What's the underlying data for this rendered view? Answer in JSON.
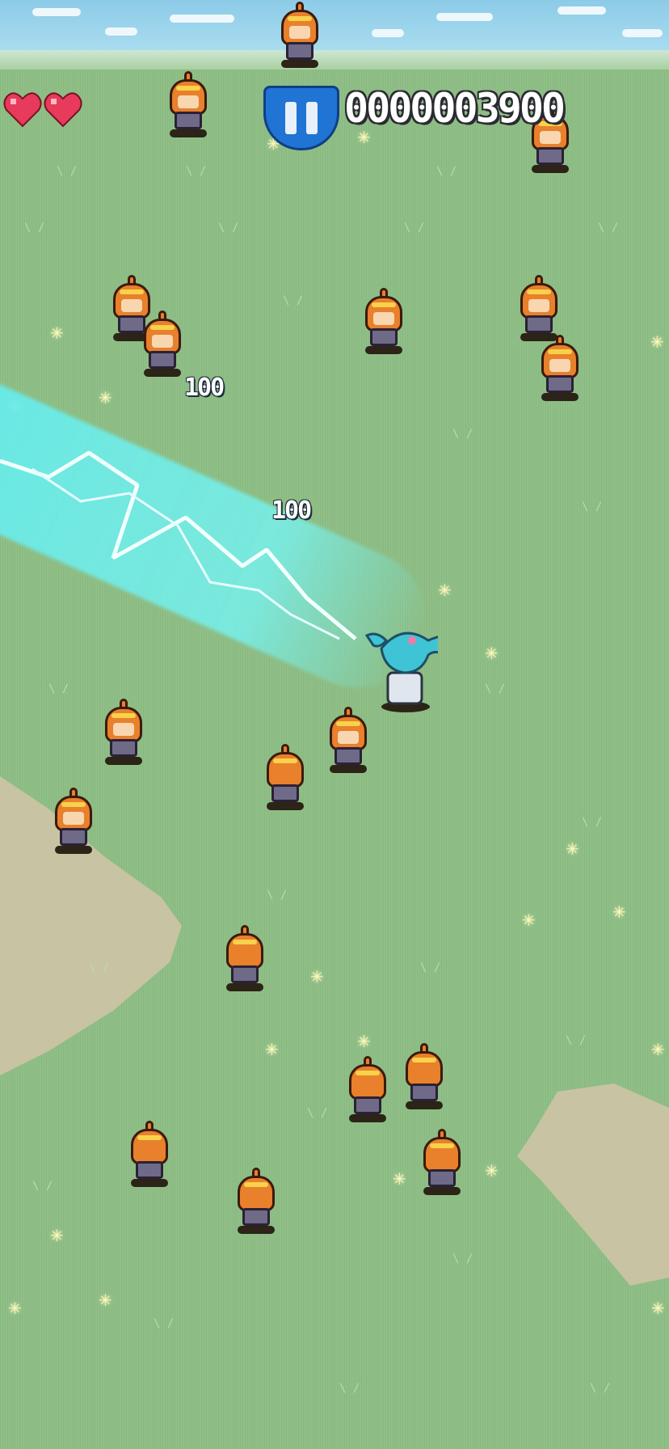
{
  "hud": {
    "lives": 2,
    "score": "0000003900",
    "heart_color": "#e83a5a"
  },
  "popups": [
    "100",
    "100"
  ],
  "colors": {
    "grass": "#8fbf86",
    "sky": "#8ccbe8",
    "beam": "#6ee8e6",
    "enemy_hair": "#e8802c",
    "hero_hair": "#3fc4d6"
  },
  "icons": [
    "heart-icon",
    "pause-icon"
  ]
}
